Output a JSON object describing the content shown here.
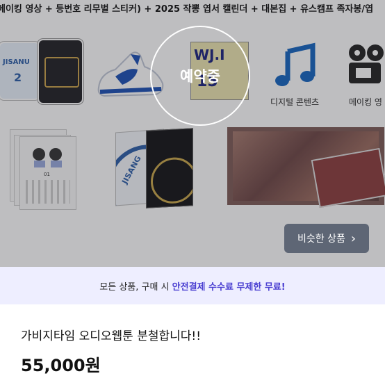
{
  "hero": {
    "top_text": "메이킹 영상 + 등번호 리무벌 스티커) + 2025 작뽕 엽서 캘린더 + 대본집 + 유스캠프 족자봉/엽",
    "digital_label": "디지털 콘텐츠",
    "making_label": "메이킹 영",
    "reserve_label": "예약중",
    "similar_button": "비슷한 상품",
    "similar_chevron": "›",
    "jersey_front_text": "JISANU",
    "jersey_num": "2",
    "book_text": "JISANG",
    "card_nums": "15",
    "cal_num": "01"
  },
  "banner": {
    "prefix": "모든 상품, 구매 시 ",
    "highlight": "안전결제 수수료 무제한 무료!"
  },
  "product": {
    "title": "가비지타임 오디오웹툰 분철합니다!!",
    "price": "55,000원"
  },
  "colors": {
    "accent": "#4a3fd1",
    "button_bg": "#5e6675",
    "banner_bg": "#eeeeff",
    "music_icon": "#1565c0"
  },
  "icons": {
    "music": "music-note-icon",
    "camera": "film-camera-icon",
    "chevron": "chevron-right-icon"
  }
}
